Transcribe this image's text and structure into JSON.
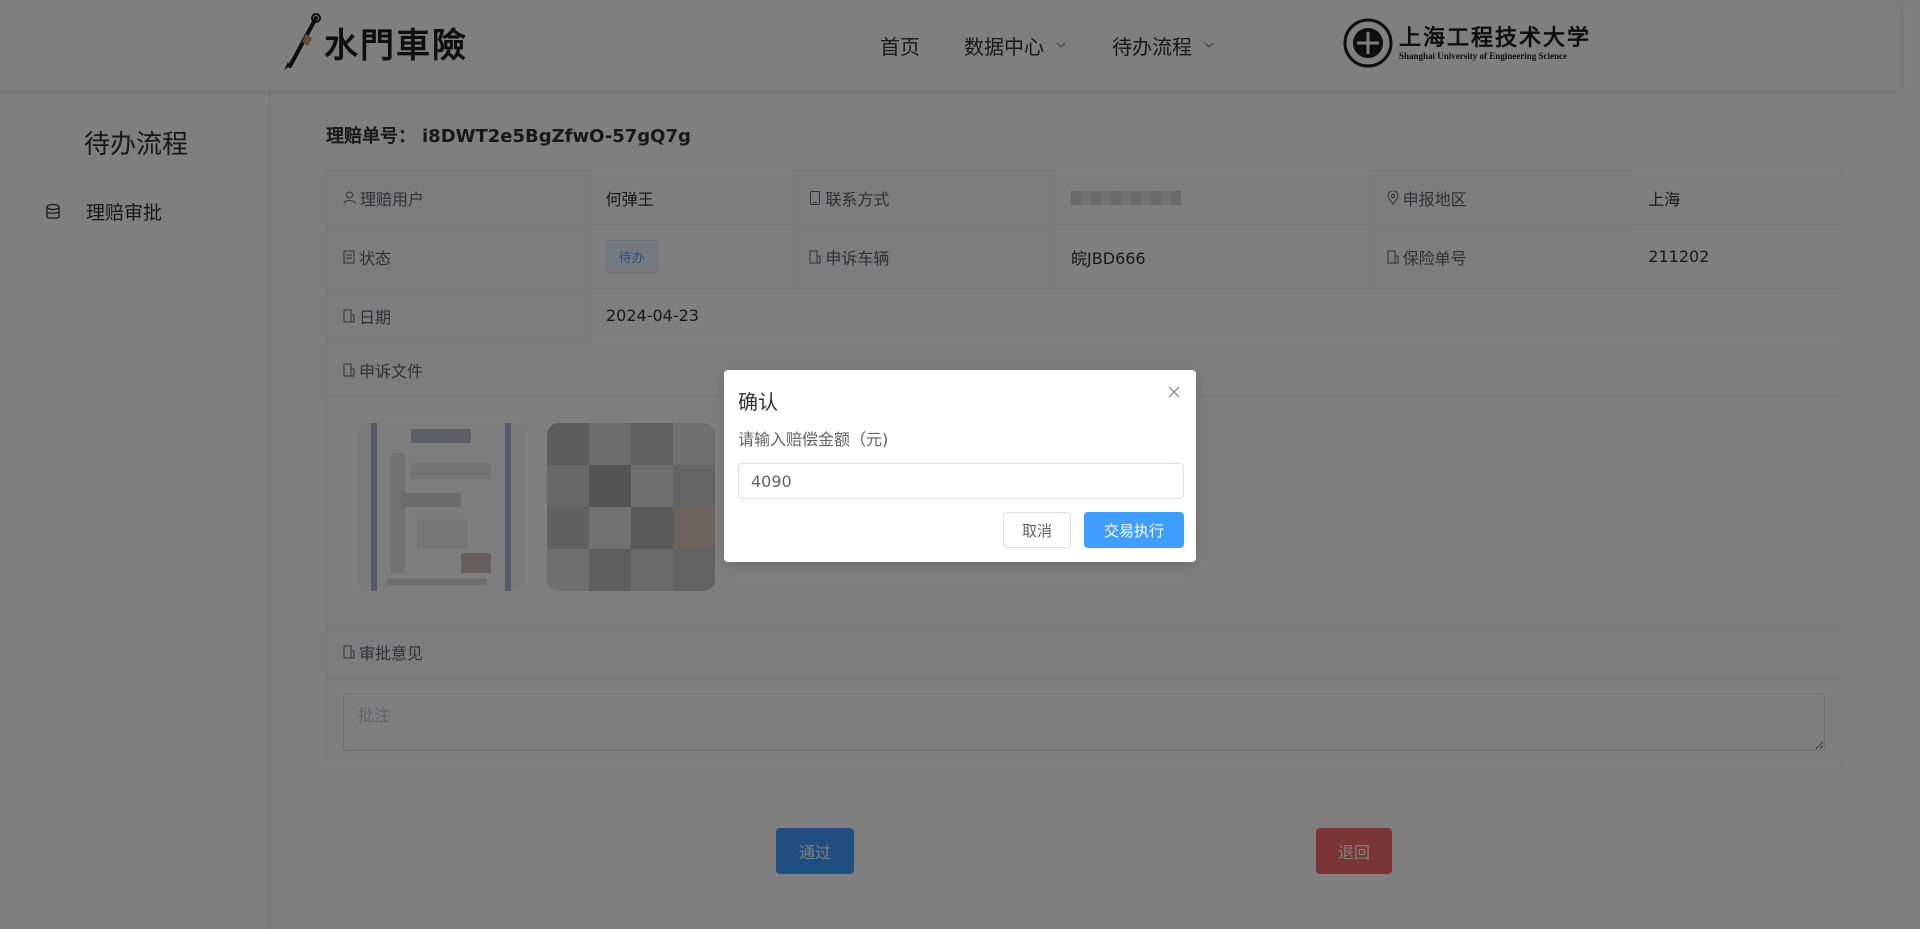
{
  "header": {
    "logo_text": "水門車險",
    "nav": [
      {
        "label": "首页",
        "has_dropdown": false
      },
      {
        "label": "数据中心",
        "has_dropdown": true
      },
      {
        "label": "待办流程",
        "has_dropdown": true
      }
    ],
    "university_cn": "上海工程技术大学",
    "university_en": "Shanghai University of Engineering Science"
  },
  "sidebar": {
    "title": "待办流程",
    "items": [
      {
        "label": "理赔审批",
        "icon": "database-icon"
      }
    ]
  },
  "main": {
    "claim_no_label": "理赔单号：",
    "claim_no": "i8DWT2e5BgZfwO-57gQ7g",
    "details": {
      "user_label": "理赔用户",
      "user": "何弹王",
      "contact_label": "联系方式",
      "contact_redacted": true,
      "region_label": "申报地区",
      "region": "上海",
      "status_label": "状态",
      "status": "待办",
      "vehicle_label": "申诉车辆",
      "vehicle": "皖JBD666",
      "policy_label": "保险单号",
      "policy": "211202",
      "date_label": "日期",
      "date": "2024-04-23"
    },
    "files_label": "申诉文件",
    "remark_label": "审批意见",
    "remark_placeholder": "批注",
    "pass_label": "通过",
    "reject_label": "退回"
  },
  "dialog": {
    "title": "确认",
    "message": "请输入赔偿金额（元)",
    "amount": "4090",
    "cancel_label": "取消",
    "confirm_label": "交易执行"
  },
  "colors": {
    "primary": "#409eff",
    "danger": "#f56c6c",
    "tag_bg": "#ecf5ff",
    "overlay": "rgba(0,0,0,0.5)"
  }
}
